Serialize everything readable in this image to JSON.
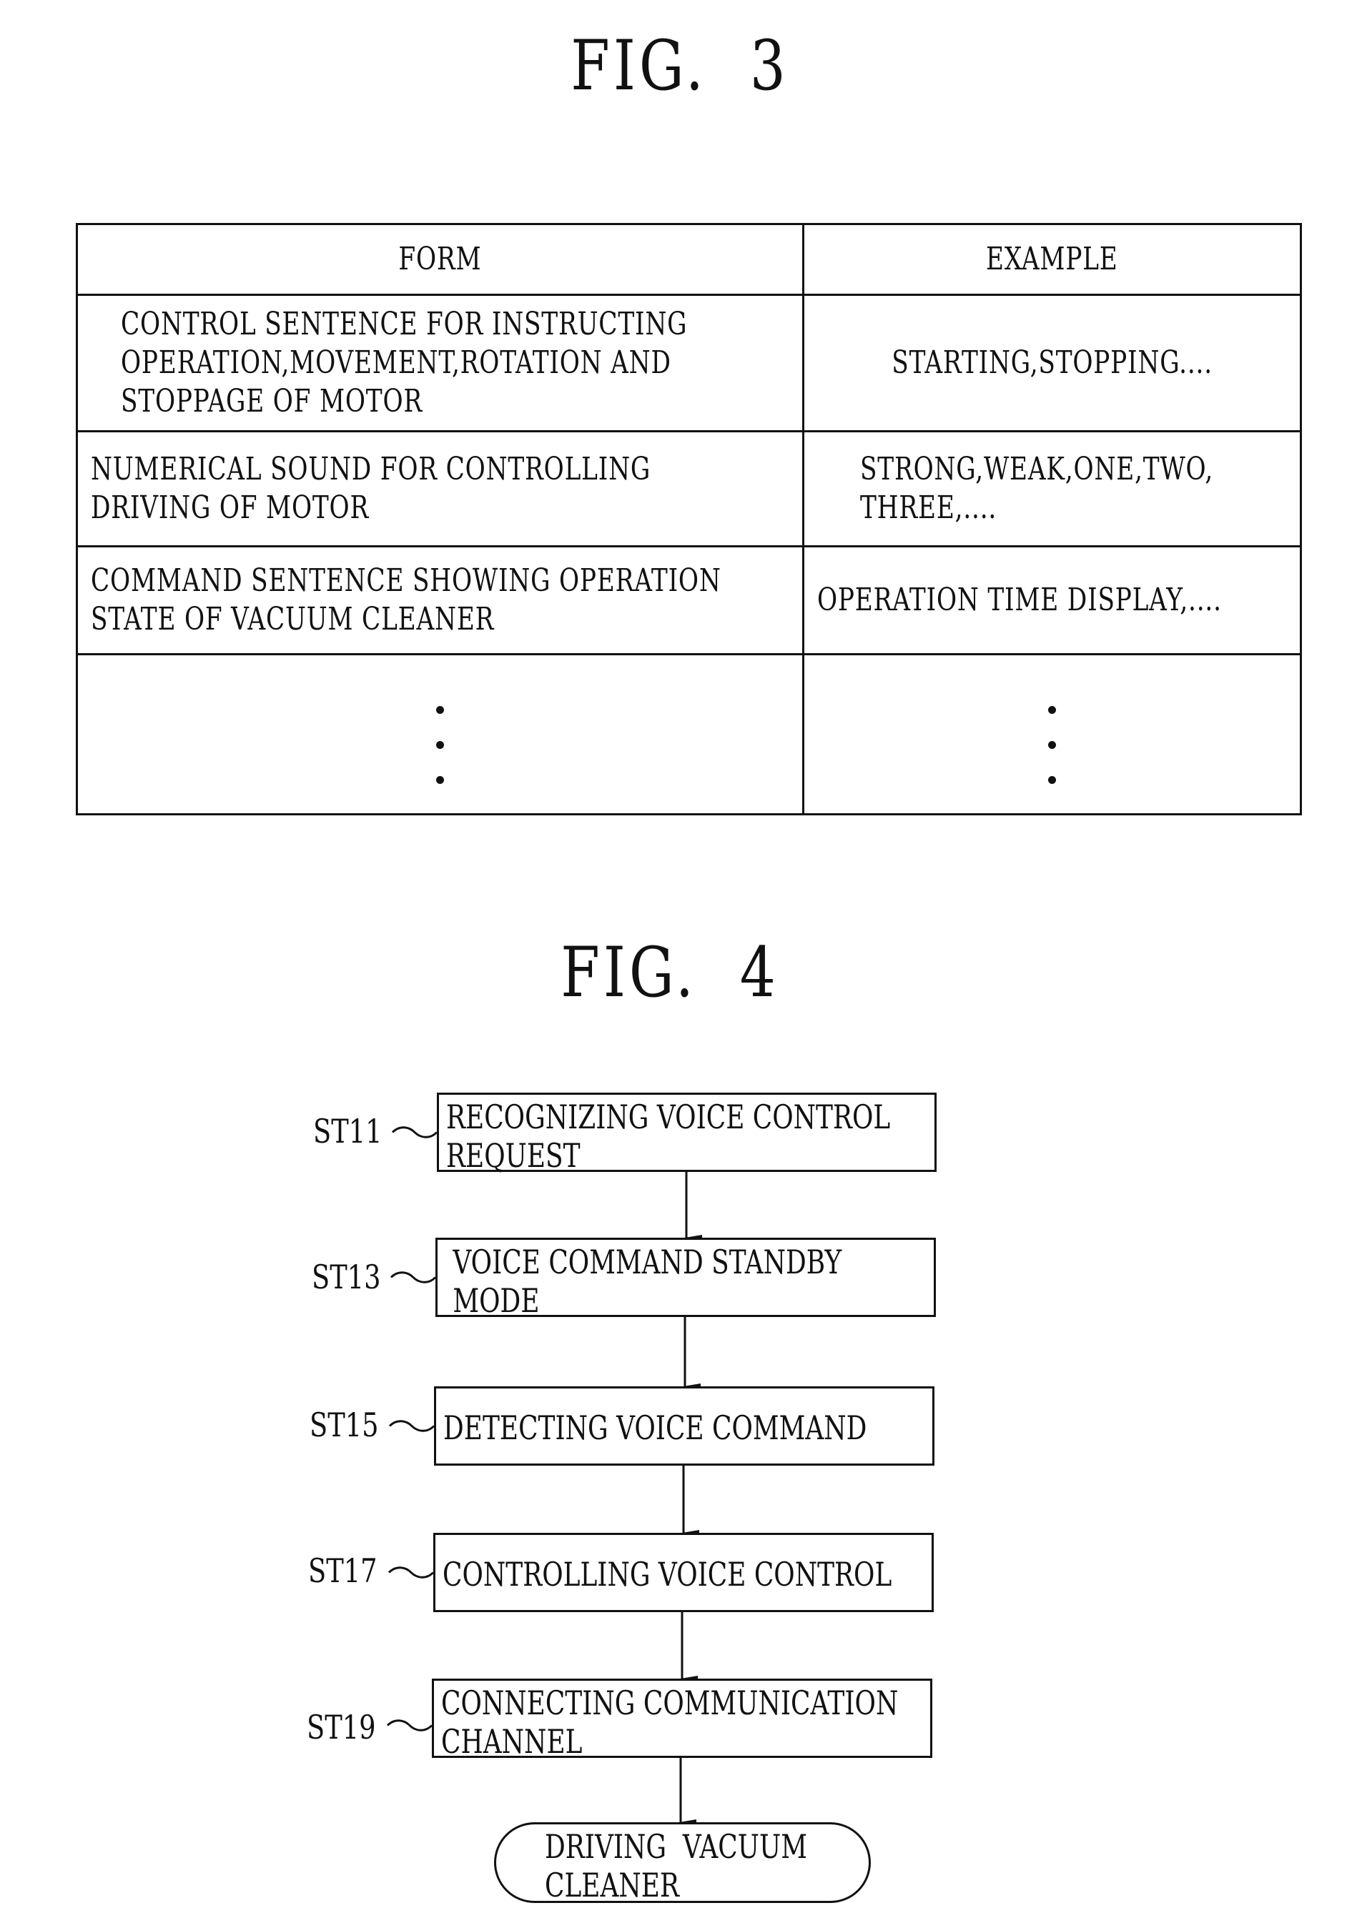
{
  "fig3": {
    "title": "FIG.  3",
    "table": {
      "headers": [
        "FORM",
        "EXAMPLE"
      ],
      "rows": [
        {
          "form": "CONTROL SENTENCE FOR INSTRUCTING\nOPERATION,MOVEMENT,ROTATION AND\nSTOPPAGE OF MOTOR",
          "example": "STARTING,STOPPING...."
        },
        {
          "form": "NUMERICAL SOUND FOR CONTROLLING\nDRIVING OF MOTOR",
          "example": "STRONG,WEAK,ONE,TWO,\nTHREE,...."
        },
        {
          "form": "COMMAND SENTENCE SHOWING OPERATION\nSTATE OF VACUUM CLEANER",
          "example": "OPERATION TIME DISPLAY,...."
        },
        {
          "form": "vertical-ellipsis",
          "example": "vertical-ellipsis"
        }
      ]
    }
  },
  "fig4": {
    "title": "FIG.  4",
    "steps": [
      {
        "id": "ST11",
        "text": "RECOGNIZING VOICE CONTROL\nREQUEST"
      },
      {
        "id": "ST13",
        "text": " VOICE COMMAND STANDBY\n MODE"
      },
      {
        "id": "ST15",
        "text": "DETECTING VOICE COMMAND"
      },
      {
        "id": "ST17",
        "text": "CONTROLLING VOICE CONTROL"
      },
      {
        "id": "ST19",
        "text": "CONNECTING COMMUNICATION\nCHANNEL"
      }
    ],
    "terminal": {
      "text": "DRIVING  VACUUM\nCLEANER"
    }
  }
}
